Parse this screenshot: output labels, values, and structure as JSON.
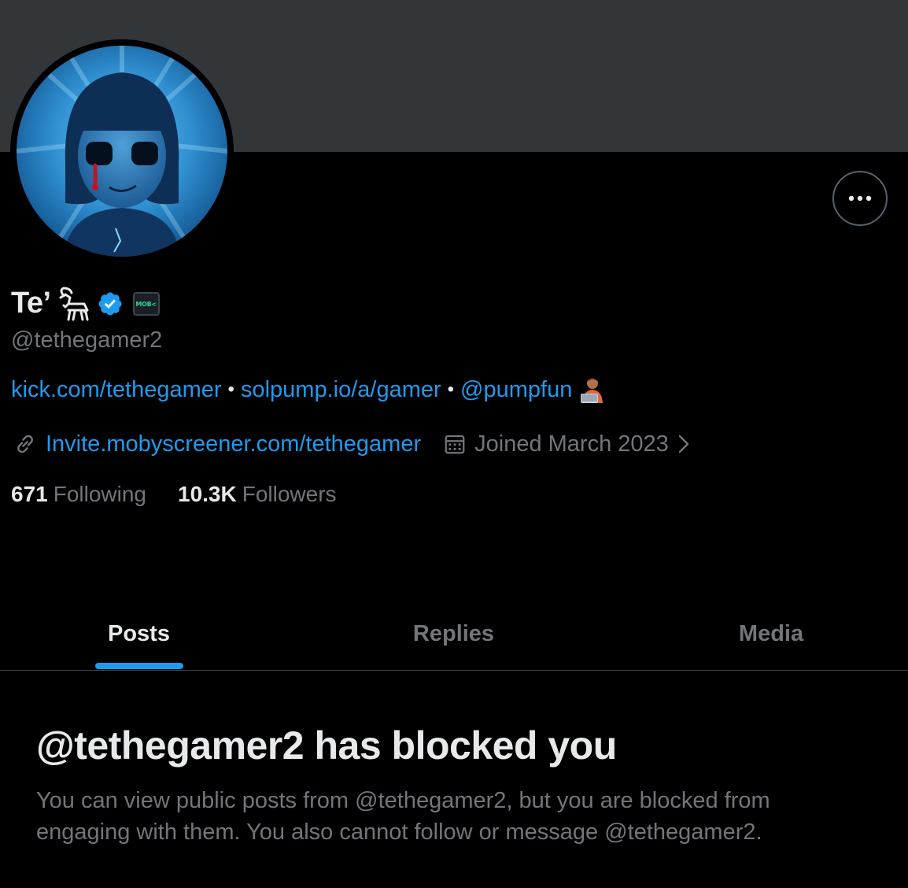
{
  "profile": {
    "display_name": "Te’",
    "handle": "@tethegamer2",
    "mob_badge_text": "MOB<",
    "bio": {
      "link1": "kick.com/tethegamer",
      "link2": "solpump.io/a/gamer",
      "mention": "@pumpfun",
      "separator": "•"
    },
    "website": "Invite.mobyscreener.com/tethegamer",
    "joined": "Joined March 2023",
    "following_count": "671",
    "following_label": "Following",
    "followers_count": "10.3K",
    "followers_label": "Followers"
  },
  "tabs": [
    {
      "label": "Posts",
      "active": true
    },
    {
      "label": "Replies",
      "active": false
    },
    {
      "label": "Media",
      "active": false
    }
  ],
  "blocked": {
    "title": "@tethegamer2 has blocked you",
    "description": "You can view public posts from @tethegamer2, but you are blocked from engaging with them. You also cannot follow or message @tethegamer2."
  },
  "icons": {
    "more": "more-horizontal-icon",
    "verified": "verified-badge-icon",
    "goat": "goat-icon",
    "link": "link-icon",
    "calendar": "calendar-icon",
    "chevron": "chevron-right-icon",
    "emoji": "technologist-emoji-icon"
  },
  "colors": {
    "background": "#000000",
    "banner": "#333639",
    "accent": "#1d9bf0",
    "text_primary": "#e7e9ea",
    "text_secondary": "#71767b",
    "divider": "#3e4144"
  }
}
